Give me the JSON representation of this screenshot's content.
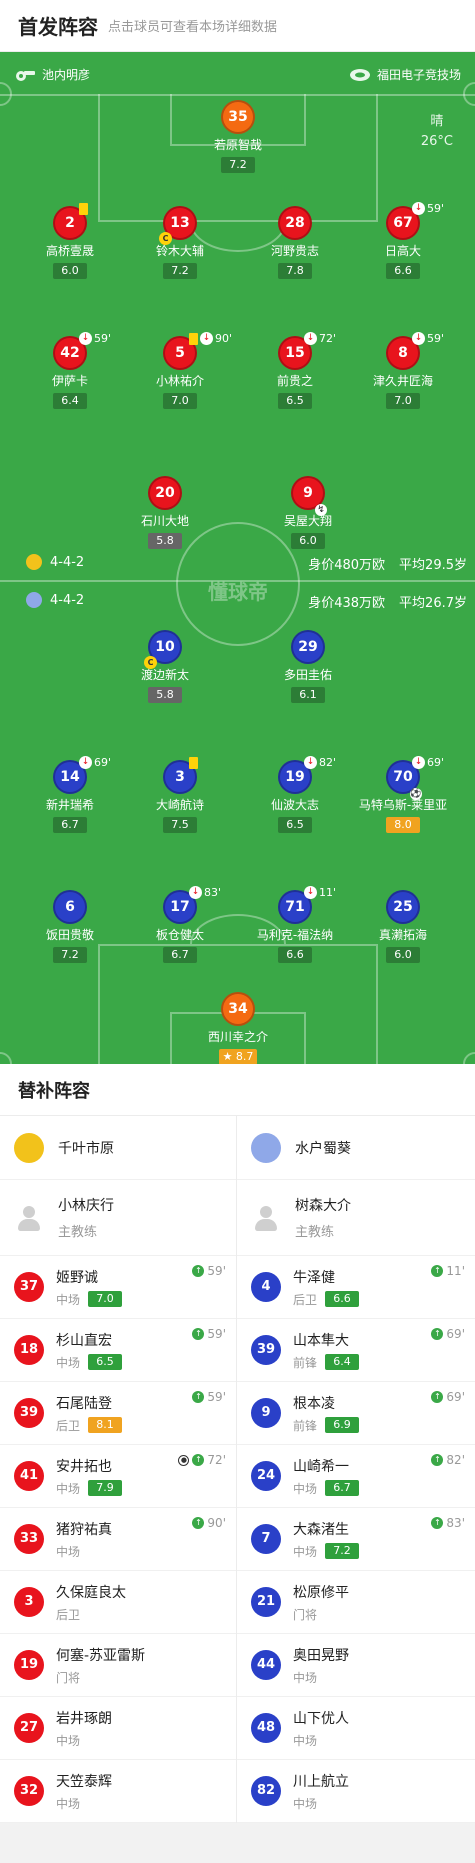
{
  "header": {
    "title": "首发阵容",
    "hint": "点击球员可查看本场详细数据"
  },
  "venue": {
    "left": "池内明彦",
    "right": "福田电子竞技场"
  },
  "weather": {
    "condition": "晴",
    "temp": "26°C"
  },
  "watermark": "懂球帝",
  "home_form": {
    "formation": "4-4-2",
    "value": "身价480万欧",
    "age": "平均29.5岁"
  },
  "away_form": {
    "formation": "4-4-2",
    "value": "身价438万欧",
    "age": "平均26.7岁"
  },
  "home_players": [
    {
      "num": "35",
      "name": "若原智哉",
      "rating": "7.2"
    },
    {
      "num": "2",
      "name": "高桥壹晟",
      "rating": "6.0"
    },
    {
      "num": "13",
      "name": "铃木大辅",
      "rating": "7.2"
    },
    {
      "num": "28",
      "name": "河野贵志",
      "rating": "7.8"
    },
    {
      "num": "67",
      "name": "日高大",
      "rating": "6.6",
      "sub_min": "59'"
    },
    {
      "num": "42",
      "name": "伊萨卡",
      "rating": "6.4",
      "sub_min": "59'"
    },
    {
      "num": "5",
      "name": "小林祐介",
      "rating": "7.0",
      "sub_min": "90'"
    },
    {
      "num": "15",
      "name": "前贵之",
      "rating": "6.5",
      "sub_min": "72'"
    },
    {
      "num": "8",
      "name": "津久井匠海",
      "rating": "7.0",
      "sub_min": "59'"
    },
    {
      "num": "20",
      "name": "石川大地",
      "rating": "5.8"
    },
    {
      "num": "9",
      "name": "吴屋大翔",
      "rating": "6.0"
    }
  ],
  "away_players": [
    {
      "num": "10",
      "name": "渡边新太",
      "rating": "5.8"
    },
    {
      "num": "29",
      "name": "多田圭佑",
      "rating": "6.1"
    },
    {
      "num": "14",
      "name": "新井瑞希",
      "rating": "6.7",
      "sub_min": "69'"
    },
    {
      "num": "3",
      "name": "大崎航诗",
      "rating": "7.5"
    },
    {
      "num": "19",
      "name": "仙波大志",
      "rating": "6.5",
      "sub_min": "82'"
    },
    {
      "num": "70",
      "name": "马特乌斯-莱里亚",
      "rating": "8.0",
      "sub_min": "69'"
    },
    {
      "num": "6",
      "name": "饭田贵敬",
      "rating": "7.2"
    },
    {
      "num": "17",
      "name": "板仓健太",
      "rating": "6.7",
      "sub_min": "83'"
    },
    {
      "num": "71",
      "name": "马利克-福法纳",
      "rating": "6.6",
      "sub_min": "11'"
    },
    {
      "num": "25",
      "name": "真濑拓海",
      "rating": "6.0"
    },
    {
      "num": "34",
      "name": "西川幸之介",
      "rating": "8.7"
    }
  ],
  "subs_title": "替补阵容",
  "home_team": {
    "name": "千叶市原",
    "crest_color": "#f2c21b",
    "coach": "小林庆行",
    "coach_role": "主教练"
  },
  "away_team": {
    "name": "水户蜀葵",
    "crest_color": "#4a63c8",
    "coach": "树森大介",
    "coach_role": "主教练"
  },
  "home_subs": [
    {
      "num": "37",
      "name": "姬野诚",
      "pos": "中场",
      "rating": "7.0",
      "min": "59'"
    },
    {
      "num": "18",
      "name": "杉山直宏",
      "pos": "中场",
      "rating": "6.5",
      "min": "59'"
    },
    {
      "num": "39",
      "name": "石尾陆登",
      "pos": "后卫",
      "rating": "8.1",
      "min": "59'"
    },
    {
      "num": "41",
      "name": "安井拓也",
      "pos": "中场",
      "rating": "7.9",
      "min": "72'"
    },
    {
      "num": "33",
      "name": "猪狩祐真",
      "pos": "中场",
      "rating": "",
      "min": "90'"
    },
    {
      "num": "3",
      "name": "久保庭良太",
      "pos": "后卫",
      "rating": "",
      "min": ""
    },
    {
      "num": "19",
      "name": "何塞-苏亚雷斯",
      "pos": "门将",
      "rating": "",
      "min": ""
    },
    {
      "num": "27",
      "name": "岩井琢朗",
      "pos": "中场",
      "rating": "",
      "min": ""
    },
    {
      "num": "32",
      "name": "天笠泰辉",
      "pos": "中场",
      "rating": "",
      "min": ""
    }
  ],
  "away_subs": [
    {
      "num": "4",
      "name": "牛泽健",
      "pos": "后卫",
      "rating": "6.6",
      "min": "11'"
    },
    {
      "num": "39",
      "name": "山本隼大",
      "pos": "前锋",
      "rating": "6.4",
      "min": "69'"
    },
    {
      "num": "9",
      "name": "根本凌",
      "pos": "前锋",
      "rating": "6.9",
      "min": "69'"
    },
    {
      "num": "24",
      "name": "山崎希一",
      "pos": "中场",
      "rating": "6.7",
      "min": "82'"
    },
    {
      "num": "7",
      "name": "大森渚生",
      "pos": "中场",
      "rating": "7.2",
      "min": "83'"
    },
    {
      "num": "21",
      "name": "松原修平",
      "pos": "门将",
      "rating": "",
      "min": ""
    },
    {
      "num": "44",
      "name": "奥田晃野",
      "pos": "中场",
      "rating": "",
      "min": ""
    },
    {
      "num": "48",
      "name": "山下优人",
      "pos": "中场",
      "rating": "",
      "min": ""
    },
    {
      "num": "82",
      "name": "川上航立",
      "pos": "中场",
      "rating": "",
      "min": ""
    }
  ],
  "colors": {
    "pitch": "#3aa847",
    "home": "#e8141d",
    "away": "#2a40c8",
    "gold": "#f0a320"
  }
}
